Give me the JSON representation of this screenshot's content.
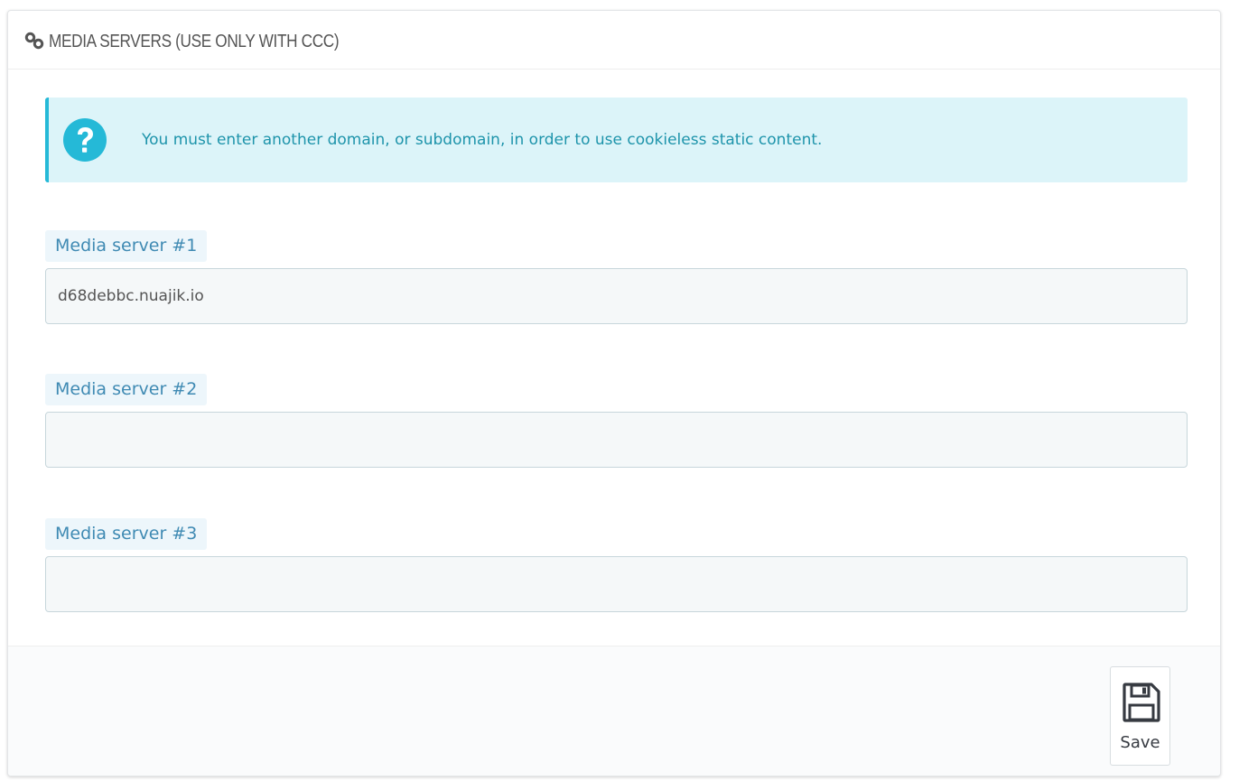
{
  "panel": {
    "title": "MEDIA SERVERS (USE ONLY WITH CCC)",
    "icon": "link-icon"
  },
  "alert": {
    "icon": "question-circle-icon",
    "message": "You must enter another domain, or subdomain, in order to use cookieless static content."
  },
  "fields": [
    {
      "label": "Media server #1",
      "value": "d68debbc.nuajik.io",
      "placeholder": ""
    },
    {
      "label": "Media server #2",
      "value": "",
      "placeholder": ""
    },
    {
      "label": "Media server #3",
      "value": "",
      "placeholder": ""
    }
  ],
  "footer": {
    "save_label": "Save",
    "save_icon": "floppy-disk-icon"
  },
  "colors": {
    "alert_background": "#dcf4f9",
    "alert_border": "#25b9d7",
    "alert_text": "#1e94ab",
    "label_text": "#3f8ab3",
    "label_background": "#edf6fb",
    "input_background": "#f5f8f9",
    "input_border": "#c7d6db"
  }
}
